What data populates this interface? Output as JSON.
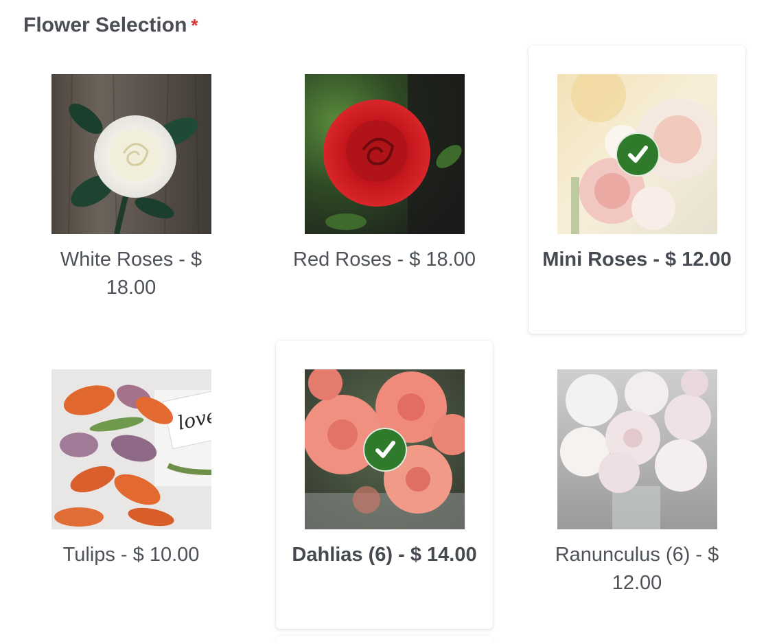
{
  "field": {
    "label": "Flower Selection",
    "required_mark": "*"
  },
  "choices": [
    {
      "label": "White Roses - $ 18.00",
      "selected": false,
      "image": "white-rose-image"
    },
    {
      "label": "Red Roses - $ 18.00",
      "selected": false,
      "image": "red-rose-image"
    },
    {
      "label": "Mini Roses - $ 12.00",
      "selected": true,
      "image": "mini-roses-image"
    },
    {
      "label": "Tulips - $ 10.00",
      "selected": false,
      "image": "tulips-image",
      "image_text": "love."
    },
    {
      "label": "Dahlias (6) - $ 14.00",
      "selected": true,
      "image": "dahlias-image"
    },
    {
      "label": "Ranunculus (6) - $ 12.00",
      "selected": false,
      "image": "ranunculus-image"
    }
  ],
  "colors": {
    "check_badge": "#2f7a2b",
    "required": "#d9352e",
    "text": "#4d5259"
  },
  "icons": {
    "selected": "checkmark-icon"
  }
}
